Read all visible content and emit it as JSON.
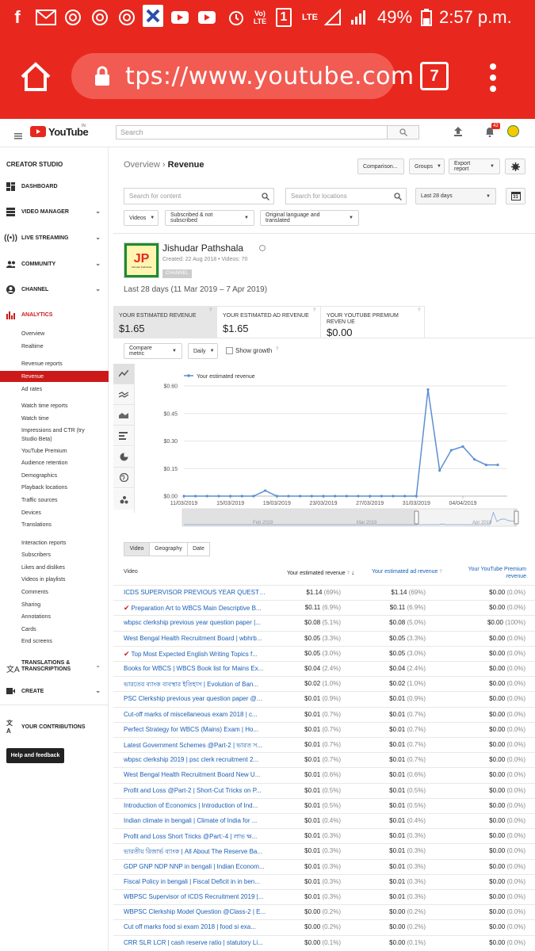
{
  "status_bar": {
    "battery": "49%",
    "time": "2:57 p.m.",
    "network_label": "LTE",
    "volte_label": "Vo) LTE",
    "sim": "1"
  },
  "browser": {
    "url": "tps://www.youtube.com",
    "tab_count": "7"
  },
  "youtube": {
    "logo_text": "YouTube",
    "region": "IN",
    "search_placeholder": "Search",
    "notification_count": "42"
  },
  "sidebar": {
    "title": "CREATOR STUDIO",
    "dashboard": "DASHBOARD",
    "video_manager": "VIDEO MANAGER",
    "live_streaming": "LIVE STREAMING",
    "community": "COMMUNITY",
    "channel": "CHANNEL",
    "analytics": "ANALYTICS",
    "analytics_items": [
      "Overview",
      "Realtime"
    ],
    "revenue_items": [
      "Revenue reports",
      "Revenue",
      "Ad rates"
    ],
    "watch_items": [
      "Watch time reports",
      "Watch time",
      "Impressions and CTR (try",
      "Studio Beta)",
      "YouTube Premium",
      "Audience retention",
      "Demographics",
      "Playback locations",
      "Traffic sources",
      "Devices",
      "Translations"
    ],
    "interaction_items": [
      "Interaction reports",
      "Subscribers",
      "Likes and dislikes",
      "Videos in playlists",
      "Comments",
      "Sharing",
      "Annotations",
      "Cards",
      "End screens"
    ],
    "translations": "TRANSLATIONS &",
    "translations2": "TRANSCRIPTIONS",
    "create": "CREATE",
    "contributions": "YOUR CONTRIBUTIONS",
    "help": "Help and feedback"
  },
  "page": {
    "breadcrumb_root": "Overview",
    "breadcrumb_sep": "›",
    "breadcrumb_current": "Revenue",
    "comparison_btn": "Comparison...",
    "groups_btn": "Groups",
    "export_btn": "Export report",
    "search_content": "Search for content",
    "search_locations": "Search for locations",
    "date_range_select": "Last 28 days",
    "calendar_day": "31",
    "filter_videos": "Videos",
    "filter_subscribed": "Subscribed & not subscribed",
    "filter_language": "Original language and translated"
  },
  "channel": {
    "name": "Jishudar Pathshala",
    "meta": "Created: 22 Aug 2018 • Videos: 70",
    "badge": "CHANNEL",
    "logo_text": "JP",
    "logo_sub": "Jishudar Pathshala",
    "period": "Last 28 days (11 Mar 2019 – 7 Apr 2019)"
  },
  "cards": [
    {
      "label": "YOUR ESTIMATED REVENUE",
      "value": "$1.65"
    },
    {
      "label": "YOUR ESTIMATED AD REVENUE",
      "value": "$1.65"
    },
    {
      "label": "YOUR YOUTUBE PREMIUM REVEN UE",
      "value": "$0.00"
    }
  ],
  "chart_controls": {
    "compare": "Compare metric",
    "daily": "Daily",
    "show_growth": "Show growth"
  },
  "chart_data": {
    "type": "line",
    "series": [
      {
        "name": "Your estimated revenue",
        "color": "#5b8fd4"
      }
    ],
    "x": [
      "11/03/2019",
      "12/03/2019",
      "13/03/2019",
      "14/03/2019",
      "15/03/2019",
      "16/03/2019",
      "17/03/2019",
      "18/03/2019",
      "19/03/2019",
      "20/03/2019",
      "21/03/2019",
      "22/03/2019",
      "23/03/2019",
      "24/03/2019",
      "25/03/2019",
      "26/03/2019",
      "27/03/2019",
      "28/03/2019",
      "29/03/2019",
      "30/03/2019",
      "31/03/2019",
      "01/04/2019",
      "02/04/2019",
      "03/04/2019",
      "04/04/2019",
      "05/04/2019",
      "06/04/2019",
      "07/04/2019"
    ],
    "values": [
      0,
      0,
      0,
      0,
      0,
      0,
      0,
      0.03,
      0,
      0,
      0,
      0,
      0,
      0,
      0,
      0,
      0,
      0,
      0,
      0,
      0,
      0.58,
      0.14,
      0.25,
      0.27,
      0.2,
      0.17,
      0.17
    ],
    "x_tick_labels": [
      "11/03/2019",
      "15/03/2019",
      "19/03/2019",
      "23/03/2019",
      "27/03/2019",
      "31/03/2019",
      "04/04/2019"
    ],
    "y_tick_labels": [
      "$0.00",
      "$0.15",
      "$0.30",
      "$0.45",
      "$0.60"
    ],
    "ylim": [
      0,
      0.6
    ],
    "legend": "top-left",
    "navigator_labels": [
      "Feb 2019",
      "Mar 2019",
      "Apr 2019"
    ]
  },
  "table": {
    "tabs": [
      "Video",
      "Geography",
      "Date"
    ],
    "headers": {
      "video": "Video",
      "revenue": "Your estimated revenue",
      "ad_revenue": "Your estimated ad revenue",
      "premium": "Your YouTube Premium revenue"
    },
    "rows": [
      {
        "title": "ICDS SUPERVISOR PREVIOUS YEAR QUESTIO...",
        "rev": "$1.14",
        "rev_pct": "(69%)",
        "ad": "$1.14",
        "ad_pct": "(69%)",
        "prem": "$0.00",
        "prem_pct": "(0.0%)",
        "check": ""
      },
      {
        "title": "Preparation Art to WBCS Main Descriptive B...",
        "rev": "$0.11",
        "rev_pct": "(6.9%)",
        "ad": "$0.11",
        "ad_pct": "(6.9%)",
        "prem": "$0.00",
        "prem_pct": "(0.0%)",
        "check": "✔"
      },
      {
        "title": "wbpsc clerkship previous year question paper |...",
        "rev": "$0.08",
        "rev_pct": "(5.1%)",
        "ad": "$0.08",
        "ad_pct": "(5.0%)",
        "prem": "$0.00",
        "prem_pct": "(100%)",
        "check": ""
      },
      {
        "title": "West Bengal Health Recruitment Board | wbhrb...",
        "rev": "$0.05",
        "rev_pct": "(3.3%)",
        "ad": "$0.05",
        "ad_pct": "(3.3%)",
        "prem": "$0.00",
        "prem_pct": "(0.0%)",
        "check": ""
      },
      {
        "title": "Top Most Expected English Writing Topics f...",
        "rev": "$0.05",
        "rev_pct": "(3.0%)",
        "ad": "$0.05",
        "ad_pct": "(3.0%)",
        "prem": "$0.00",
        "prem_pct": "(0.0%)",
        "check": "✔"
      },
      {
        "title": "Books for WBCS | WBCS Book list for Mains Ex...",
        "rev": "$0.04",
        "rev_pct": "(2.4%)",
        "ad": "$0.04",
        "ad_pct": "(2.4%)",
        "prem": "$0.00",
        "prem_pct": "(0.0%)",
        "check": ""
      },
      {
        "title": "ভারতের ব্যাংক ব্যবস্থার ইতিহাস | Evolution of Ban...",
        "rev": "$0.02",
        "rev_pct": "(1.0%)",
        "ad": "$0.02",
        "ad_pct": "(1.0%)",
        "prem": "$0.00",
        "prem_pct": "(0.0%)",
        "check": ""
      },
      {
        "title": "PSC Clerkship previous year question paper @...",
        "rev": "$0.01",
        "rev_pct": "(0.9%)",
        "ad": "$0.01",
        "ad_pct": "(0.9%)",
        "prem": "$0.00",
        "prem_pct": "(0.0%)",
        "check": ""
      },
      {
        "title": "Cut-off marks of miscellaneous exam 2018 | c...",
        "rev": "$0.01",
        "rev_pct": "(0.7%)",
        "ad": "$0.01",
        "ad_pct": "(0.7%)",
        "prem": "$0.00",
        "prem_pct": "(0.0%)",
        "check": ""
      },
      {
        "title": "Perfect Strategy for WBCS (Mains) Exam | Ho...",
        "rev": "$0.01",
        "rev_pct": "(0.7%)",
        "ad": "$0.01",
        "ad_pct": "(0.7%)",
        "prem": "$0.00",
        "prem_pct": "(0.0%)",
        "check": ""
      },
      {
        "title": "Latest Government Schemes @Part-2 | ভারত স...",
        "rev": "$0.01",
        "rev_pct": "(0.7%)",
        "ad": "$0.01",
        "ad_pct": "(0.7%)",
        "prem": "$0.00",
        "prem_pct": "(0.0%)",
        "check": ""
      },
      {
        "title": "wbpsc clerkship 2019 | psc clerk recruitment 2...",
        "rev": "$0.01",
        "rev_pct": "(0.7%)",
        "ad": "$0.01",
        "ad_pct": "(0.7%)",
        "prem": "$0.00",
        "prem_pct": "(0.0%)",
        "check": ""
      },
      {
        "title": "West Bengal Health Recruitment Board New U...",
        "rev": "$0.01",
        "rev_pct": "(0.6%)",
        "ad": "$0.01",
        "ad_pct": "(0.6%)",
        "prem": "$0.00",
        "prem_pct": "(0.0%)",
        "check": ""
      },
      {
        "title": "Profit and Loss @Part-2 | Short-Cut Tricks on P...",
        "rev": "$0.01",
        "rev_pct": "(0.5%)",
        "ad": "$0.01",
        "ad_pct": "(0.5%)",
        "prem": "$0.00",
        "prem_pct": "(0.0%)",
        "check": ""
      },
      {
        "title": "Introduction of Economics | Introduction of Ind...",
        "rev": "$0.01",
        "rev_pct": "(0.5%)",
        "ad": "$0.01",
        "ad_pct": "(0.5%)",
        "prem": "$0.00",
        "prem_pct": "(0.0%)",
        "check": ""
      },
      {
        "title": "Indian climate in bengali | Climate of India for ...",
        "rev": "$0.01",
        "rev_pct": "(0.4%)",
        "ad": "$0.01",
        "ad_pct": "(0.4%)",
        "prem": "$0.00",
        "prem_pct": "(0.0%)",
        "check": ""
      },
      {
        "title": "Profit and Loss Short Tricks @Part:-4 | লাভ ক্ষ...",
        "rev": "$0.01",
        "rev_pct": "(0.3%)",
        "ad": "$0.01",
        "ad_pct": "(0.3%)",
        "prem": "$0.00",
        "prem_pct": "(0.0%)",
        "check": ""
      },
      {
        "title": "ভারতীয় রিজার্ভ ব্যাংক | All About The Reserve Ba...",
        "rev": "$0.01",
        "rev_pct": "(0.3%)",
        "ad": "$0.01",
        "ad_pct": "(0.3%)",
        "prem": "$0.00",
        "prem_pct": "(0.0%)",
        "check": ""
      },
      {
        "title": "GDP GNP NDP NNP in bengali | Indian Econom...",
        "rev": "$0.01",
        "rev_pct": "(0.3%)",
        "ad": "$0.01",
        "ad_pct": "(0.3%)",
        "prem": "$0.00",
        "prem_pct": "(0.0%)",
        "check": ""
      },
      {
        "title": "Fiscal Policy in bengali | Fiscal Deficit in in ben...",
        "rev": "$0.01",
        "rev_pct": "(0.3%)",
        "ad": "$0.01",
        "ad_pct": "(0.3%)",
        "prem": "$0.00",
        "prem_pct": "(0.0%)",
        "check": ""
      },
      {
        "title": "WBPSC Supervisor of ICDS Recruitment 2019 |...",
        "rev": "$0.01",
        "rev_pct": "(0.3%)",
        "ad": "$0.01",
        "ad_pct": "(0.3%)",
        "prem": "$0.00",
        "prem_pct": "(0.0%)",
        "check": ""
      },
      {
        "title": "WBPSC Clerkship Model Question @Class-2 | E...",
        "rev": "$0.00",
        "rev_pct": "(0.2%)",
        "ad": "$0.00",
        "ad_pct": "(0.2%)",
        "prem": "$0.00",
        "prem_pct": "(0.0%)",
        "check": ""
      },
      {
        "title": "Cut off marks food si exam 2018 | food si exa...",
        "rev": "$0.00",
        "rev_pct": "(0.2%)",
        "ad": "$0.00",
        "ad_pct": "(0.2%)",
        "prem": "$0.00",
        "prem_pct": "(0.0%)",
        "check": ""
      },
      {
        "title": "CRR SLR LCR | cash reserve ratio | statutory Li...",
        "rev": "$0.00",
        "rev_pct": "(0.1%)",
        "ad": "$0.00",
        "ad_pct": "(0.1%)",
        "prem": "$0.00",
        "prem_pct": "(0.0%)",
        "check": ""
      }
    ]
  },
  "colors": {
    "android_red": "#e8281e",
    "youtube_red": "#cc1a1a",
    "link_blue": "#1a5fb4",
    "chart_line": "#5b8fd4"
  }
}
